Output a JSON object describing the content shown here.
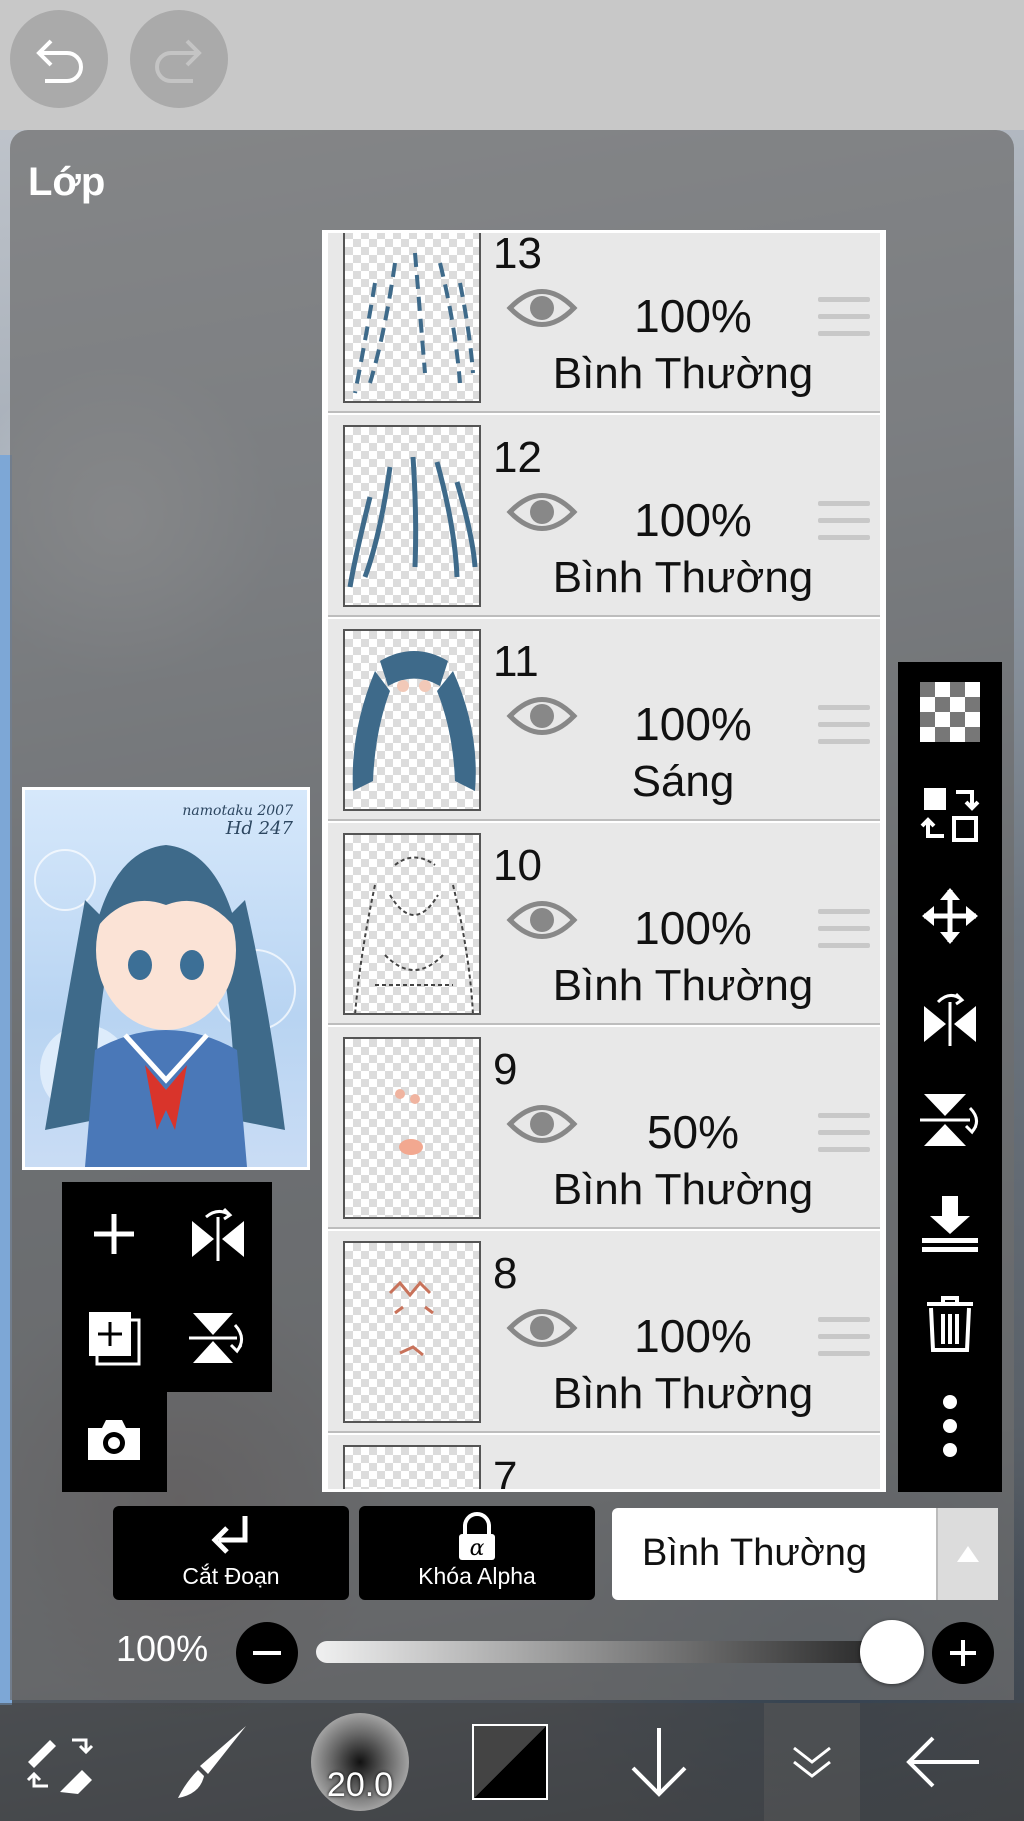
{
  "app": {
    "panel_title": "Lớp"
  },
  "top_buttons": {
    "undo_icon": "undo-icon",
    "redo_icon": "redo-icon"
  },
  "layers": [
    {
      "number": "13",
      "opacity": "100%",
      "blend": "Bình Thường",
      "visible": true
    },
    {
      "number": "12",
      "opacity": "100%",
      "blend": "Bình Thường",
      "visible": true
    },
    {
      "number": "11",
      "opacity": "100%",
      "blend": "Sáng",
      "visible": true
    },
    {
      "number": "10",
      "opacity": "100%",
      "blend": "Bình Thường",
      "visible": true
    },
    {
      "number": "9",
      "opacity": "50%",
      "blend": "Bình Thường",
      "visible": true
    },
    {
      "number": "8",
      "opacity": "100%",
      "blend": "Bình Thường",
      "visible": true
    },
    {
      "number": "7",
      "opacity": "",
      "blend": "",
      "visible": true
    }
  ],
  "preview": {
    "signature_line1": "namotaku 2007",
    "signature_line2": "Hd 247"
  },
  "controls": {
    "clipping_label": "Cắt Đoạn",
    "alpha_lock_label": "Khóa Alpha",
    "blend_mode": "Bình Thường",
    "layer_opacity": "100%",
    "opacity_value": 1.0
  },
  "bottom_toolbar": {
    "brush_size": "20.0"
  },
  "colors": {
    "panel_bg": "#6e6e6e",
    "row_bg": "#e8e8e8",
    "toolbar_bg": "#000000",
    "accent_hair": "#3e6a8a"
  }
}
